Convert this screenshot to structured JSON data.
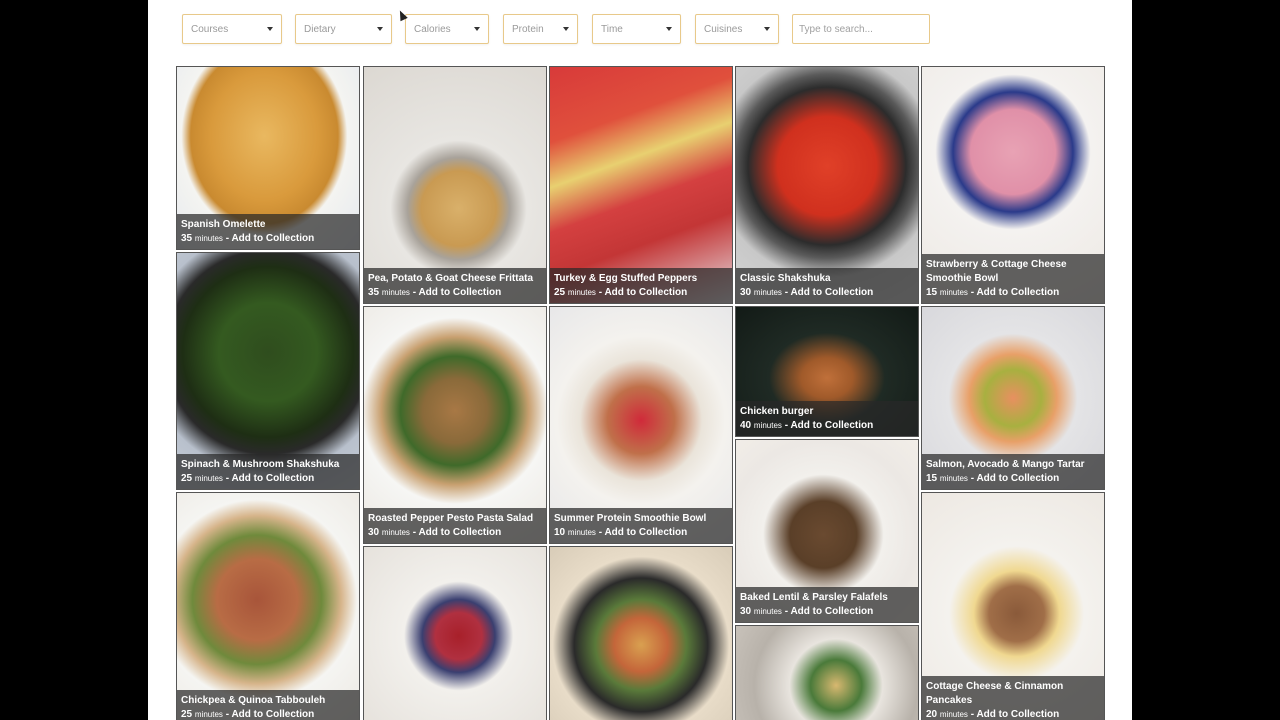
{
  "filters": {
    "courses": "Courses",
    "dietary": "Dietary",
    "calories": "Calories",
    "protein": "Protein",
    "time": "Time",
    "cuisines": "Cuisines",
    "search_placeholder": "Type to search..."
  },
  "recipes": [
    {
      "title": "Spanish Omelette",
      "minutes": "35",
      "unit": "minutes",
      "sep": " - ",
      "action": "Add to Collection"
    },
    {
      "title": "Pea, Potato & Goat Cheese Frittata",
      "minutes": "35",
      "unit": "minutes",
      "sep": " - ",
      "action": "Add to Collection"
    },
    {
      "title": "Turkey & Egg Stuffed Peppers",
      "minutes": "25",
      "unit": "minutes",
      "sep": " - ",
      "action": "Add to Collection"
    },
    {
      "title": "Classic Shakshuka",
      "minutes": "30",
      "unit": "minutes",
      "sep": " - ",
      "action": "Add to Collection"
    },
    {
      "title": "Strawberry & Cottage Cheese Smoothie Bowl",
      "minutes": "15",
      "unit": "minutes",
      "sep": " - ",
      "action": "Add to Collection"
    },
    {
      "title": "Spinach & Mushroom Shakshuka",
      "minutes": "25",
      "unit": "minutes",
      "sep": " - ",
      "action": "Add to Collection"
    },
    {
      "title": "Roasted Pepper Pesto Pasta Salad",
      "minutes": "30",
      "unit": "minutes",
      "sep": " - ",
      "action": "Add to Collection"
    },
    {
      "title": "Summer Protein Smoothie Bowl",
      "minutes": "10",
      "unit": "minutes",
      "sep": " - ",
      "action": "Add to Collection"
    },
    {
      "title": "Chicken burger",
      "minutes": "40",
      "unit": "minutes",
      "sep": " - ",
      "action": "Add to Collection"
    },
    {
      "title": "Salmon, Avocado & Mango Tartar",
      "minutes": "15",
      "unit": "minutes",
      "sep": " - ",
      "action": "Add to Collection"
    },
    {
      "title": "Chickpea & Quinoa Tabbouleh",
      "minutes": "25",
      "unit": "minutes",
      "sep": " - ",
      "action": "Add to Collection"
    },
    {
      "title": "Baked Lentil & Parsley Falafels",
      "minutes": "30",
      "unit": "minutes",
      "sep": " - ",
      "action": "Add to Collection"
    },
    {
      "title": "Cottage Cheese & Cinnamon Pancakes",
      "minutes": "20",
      "unit": "minutes",
      "sep": " - ",
      "action": "Add to Collection"
    }
  ],
  "colors": {
    "filter_border": "#e8c98a",
    "caption_bg": "#282828",
    "page_bg": "#ffffff",
    "outer_bg": "#000000"
  }
}
